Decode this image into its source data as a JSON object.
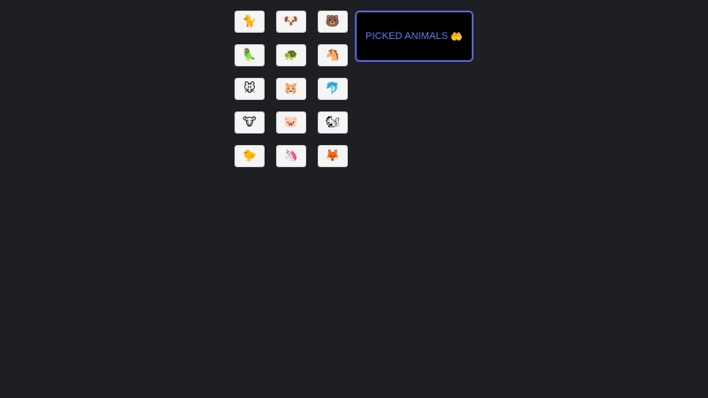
{
  "animals": [
    {
      "id": "cat",
      "glyph": "🐈"
    },
    {
      "id": "dog",
      "glyph": "🐶"
    },
    {
      "id": "bear",
      "glyph": "🐻"
    },
    {
      "id": "parrot",
      "glyph": "🦜"
    },
    {
      "id": "turtle",
      "glyph": "🐢"
    },
    {
      "id": "horse",
      "glyph": "🐴"
    },
    {
      "id": "mouse",
      "glyph": "🐭"
    },
    {
      "id": "hamster",
      "glyph": "🐹"
    },
    {
      "id": "dolphin",
      "glyph": "🐬"
    },
    {
      "id": "cow",
      "glyph": "🐮"
    },
    {
      "id": "pig",
      "glyph": "🐷"
    },
    {
      "id": "chipmunk",
      "glyph": "🐿"
    },
    {
      "id": "chick",
      "glyph": "🐤"
    },
    {
      "id": "unicorn",
      "glyph": "🦄"
    },
    {
      "id": "fox",
      "glyph": "🦊"
    }
  ],
  "picked": {
    "label": "PICKED ANIMALS",
    "icon": "🤲"
  },
  "colors": {
    "background": "#1e1f23",
    "tile": "#f5f5f5",
    "accent": "#5b63d8",
    "label": "#6f78f0"
  }
}
